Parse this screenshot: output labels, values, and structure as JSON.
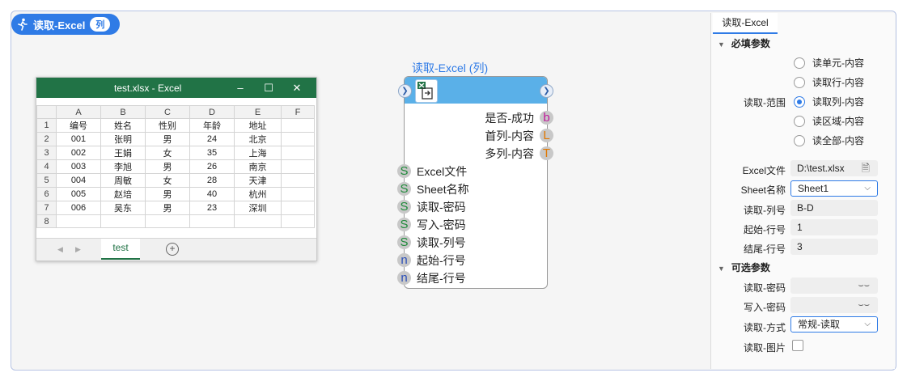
{
  "header": {
    "title": "读取-Excel",
    "tag": "列"
  },
  "excel": {
    "window_title": "test.xlsx  -  Excel",
    "minimize": "–",
    "maximize": "☐",
    "close": "✕",
    "columns": [
      "A",
      "B",
      "C",
      "D",
      "E",
      "F"
    ],
    "row_numbers": [
      "1",
      "2",
      "3",
      "4",
      "5",
      "6",
      "7",
      "8"
    ],
    "rows": [
      [
        "编号",
        "姓名",
        "性别",
        "年龄",
        "地址",
        ""
      ],
      [
        "001",
        "张明",
        "男",
        "24",
        "北京",
        ""
      ],
      [
        "002",
        "王娟",
        "女",
        "35",
        "上海",
        ""
      ],
      [
        "003",
        "李旭",
        "男",
        "26",
        "南京",
        ""
      ],
      [
        "004",
        "周敏",
        "女",
        "28",
        "天津",
        ""
      ],
      [
        "005",
        "赵培",
        "男",
        "40",
        "杭州",
        ""
      ],
      [
        "006",
        "吴东",
        "男",
        "23",
        "深圳",
        ""
      ],
      [
        "",
        "",
        "",
        "",
        "",
        ""
      ]
    ],
    "sheet_tab": "test",
    "add_sheet": "+"
  },
  "node": {
    "title": "读取-Excel (列)",
    "outputs": [
      {
        "label": "是否-成功",
        "type": "b",
        "color": "#c0189c"
      },
      {
        "label": "首列-内容",
        "type": "L",
        "color": "#e07800"
      },
      {
        "label": "多列-内容",
        "type": "T",
        "color": "#e07800"
      }
    ],
    "inputs": [
      {
        "label": "Excel文件",
        "type": "S",
        "color": "#1f8a3a"
      },
      {
        "label": "Sheet名称",
        "type": "S",
        "color": "#1f8a3a"
      },
      {
        "label": "读取-密码",
        "type": "S",
        "color": "#1f8a3a"
      },
      {
        "label": "写入-密码",
        "type": "S",
        "color": "#1f8a3a"
      },
      {
        "label": "读取-列号",
        "type": "S",
        "color": "#1f8a3a"
      },
      {
        "label": "起始-行号",
        "type": "n",
        "color": "#2b4fb8"
      },
      {
        "label": "结尾-行号",
        "type": "n",
        "color": "#2b4fb8"
      }
    ]
  },
  "panel": {
    "tab": "读取-Excel",
    "required_title": "必填参数",
    "range_label": "读取-范围",
    "range_options": [
      "读单元-内容",
      "读取行-内容",
      "读取列-内容",
      "读区域-内容",
      "读全部-内容"
    ],
    "range_selected": 2,
    "excel_file_label": "Excel文件",
    "excel_file_value": "D:\\test.xlsx",
    "sheet_label": "Sheet名称",
    "sheet_value": "Sheet1",
    "column_label": "读取-列号",
    "column_value": "B-D",
    "start_label": "起始-行号",
    "start_value": "1",
    "end_label": "结尾-行号",
    "end_value": "3",
    "optional_title": "可选参数",
    "read_pwd_label": "读取-密码",
    "write_pwd_label": "写入-密码",
    "mode_label": "读取-方式",
    "mode_value": "常规-读取",
    "image_label": "读取-图片",
    "image_checked": false
  }
}
